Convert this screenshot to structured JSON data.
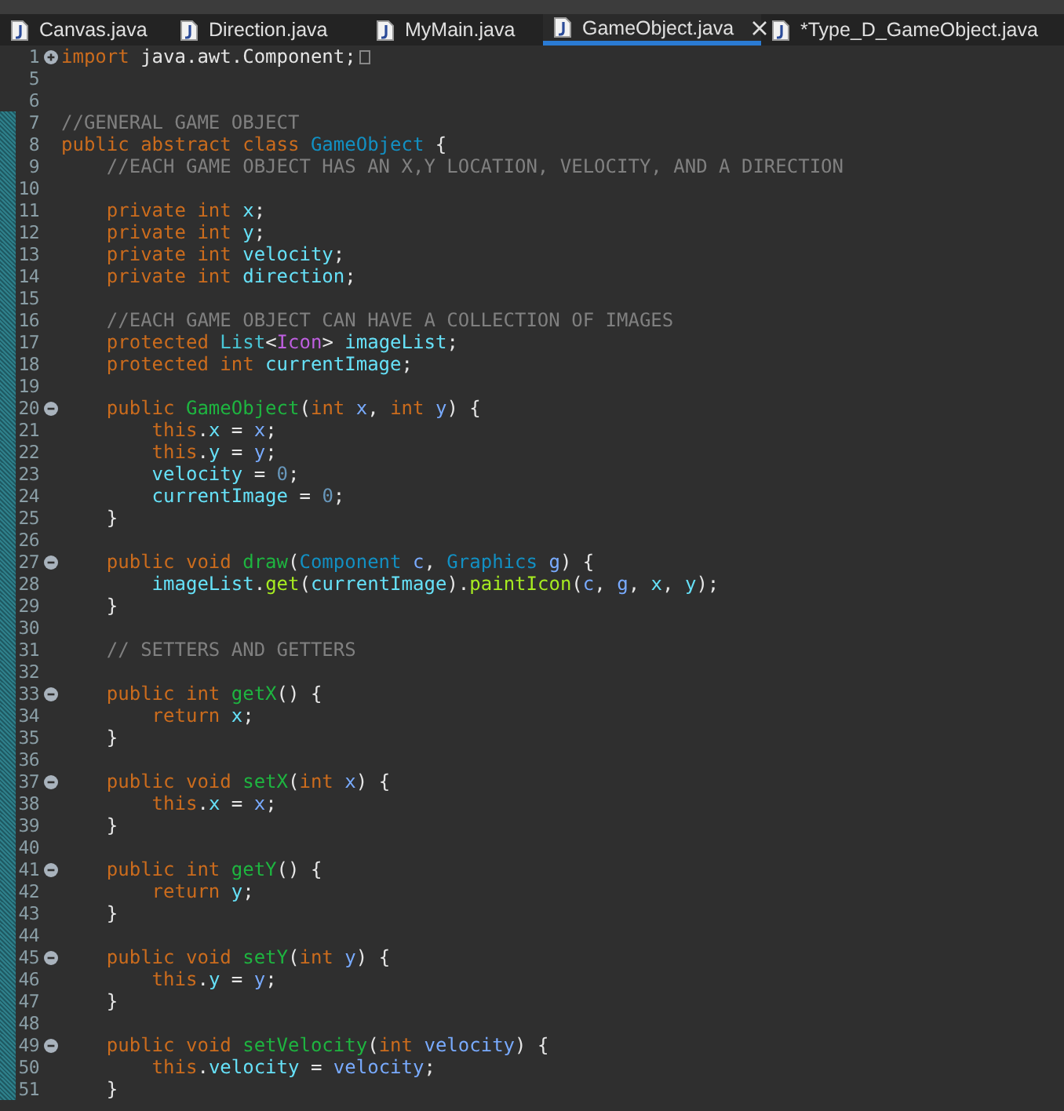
{
  "tabs": [
    {
      "label": "Canvas.java",
      "selected": false
    },
    {
      "label": "Direction.java",
      "selected": false
    },
    {
      "label": "MyMain.java",
      "selected": false
    },
    {
      "label": "GameObject.java",
      "selected": true
    },
    {
      "label": "*Type_D_GameObject.java",
      "selected": false
    }
  ],
  "lines": [
    {
      "number": "1",
      "expanded": false,
      "changed": false,
      "tokens": [
        {
          "kind": "keyword",
          "text": "import"
        },
        {
          "kind": "plain",
          "text": " java.awt.Component;"
        }
      ]
    },
    {
      "number": "5",
      "changed": false
    },
    {
      "number": "6",
      "changed": false
    },
    {
      "number": "7",
      "changed": true,
      "tokens": [
        {
          "kind": "comment",
          "text": "//GENERAL GAME OBJECT"
        }
      ]
    },
    {
      "number": "8",
      "changed": true,
      "tokens": [
        {
          "kind": "keyword",
          "text": "public abstract class "
        },
        {
          "kind": "type",
          "text": "GameObject"
        },
        {
          "kind": "plain",
          "text": " {"
        }
      ]
    },
    {
      "number": "9",
      "changed": true,
      "tokens": [
        {
          "kind": "comment",
          "text": "    //EACH GAME OBJECT HAS AN X,Y LOCATION, VELOCITY, AND A DIRECTION"
        }
      ]
    },
    {
      "number": "10",
      "changed": true
    },
    {
      "number": "11",
      "changed": true,
      "tokens": [
        {
          "kind": "keyword",
          "text": "    private int "
        },
        {
          "kind": "field",
          "text": "x"
        },
        {
          "kind": "plain",
          "text": ";"
        }
      ]
    },
    {
      "number": "12",
      "changed": true,
      "tokens": [
        {
          "kind": "keyword",
          "text": "    private int "
        },
        {
          "kind": "field",
          "text": "y"
        },
        {
          "kind": "plain",
          "text": ";"
        }
      ]
    },
    {
      "number": "13",
      "changed": true,
      "tokens": [
        {
          "kind": "keyword",
          "text": "    private int "
        },
        {
          "kind": "field",
          "text": "velocity"
        },
        {
          "kind": "plain",
          "text": ";"
        }
      ]
    },
    {
      "number": "14",
      "changed": true,
      "tokens": [
        {
          "kind": "keyword",
          "text": "    private int "
        },
        {
          "kind": "field",
          "text": "direction"
        },
        {
          "kind": "plain",
          "text": ";"
        }
      ]
    },
    {
      "number": "15",
      "changed": true
    },
    {
      "number": "16",
      "changed": true,
      "tokens": [
        {
          "kind": "comment",
          "text": "    //EACH GAME OBJECT CAN HAVE A COLLECTION OF IMAGES"
        }
      ]
    },
    {
      "number": "17",
      "changed": true,
      "tokens": [
        {
          "kind": "keyword",
          "text": "    protected "
        },
        {
          "kind": "interface",
          "text": "List"
        },
        {
          "kind": "plain",
          "text": "<"
        },
        {
          "kind": "typeparam",
          "text": "Icon"
        },
        {
          "kind": "plain",
          "text": "> "
        },
        {
          "kind": "field",
          "text": "imageList"
        },
        {
          "kind": "plain",
          "text": ";"
        }
      ]
    },
    {
      "number": "18",
      "changed": true,
      "tokens": [
        {
          "kind": "keyword",
          "text": "    protected int "
        },
        {
          "kind": "field",
          "text": "currentImage"
        },
        {
          "kind": "plain",
          "text": ";"
        }
      ]
    },
    {
      "number": "19",
      "changed": true
    },
    {
      "number": "20",
      "expanded": true,
      "changed": true,
      "tokens": [
        {
          "kind": "keyword",
          "text": "    public "
        },
        {
          "kind": "method",
          "text": "GameObject"
        },
        {
          "kind": "plain",
          "text": "("
        },
        {
          "kind": "keyword",
          "text": "int "
        },
        {
          "kind": "param",
          "text": "x"
        },
        {
          "kind": "plain",
          "text": ", "
        },
        {
          "kind": "keyword",
          "text": "int "
        },
        {
          "kind": "param",
          "text": "y"
        },
        {
          "kind": "plain",
          "text": ") {"
        }
      ]
    },
    {
      "number": "21",
      "changed": true,
      "tokens": [
        {
          "kind": "keyword",
          "text": "        this"
        },
        {
          "kind": "plain",
          "text": "."
        },
        {
          "kind": "field",
          "text": "x"
        },
        {
          "kind": "plain",
          "text": " = "
        },
        {
          "kind": "param",
          "text": "x"
        },
        {
          "kind": "plain",
          "text": ";"
        }
      ]
    },
    {
      "number": "22",
      "changed": true,
      "tokens": [
        {
          "kind": "keyword",
          "text": "        this"
        },
        {
          "kind": "plain",
          "text": "."
        },
        {
          "kind": "field",
          "text": "y"
        },
        {
          "kind": "plain",
          "text": " = "
        },
        {
          "kind": "param",
          "text": "y"
        },
        {
          "kind": "plain",
          "text": ";"
        }
      ]
    },
    {
      "number": "23",
      "changed": true,
      "tokens": [
        {
          "kind": "field",
          "text": "        velocity"
        },
        {
          "kind": "plain",
          "text": " = "
        },
        {
          "kind": "number",
          "text": "0"
        },
        {
          "kind": "plain",
          "text": ";"
        }
      ]
    },
    {
      "number": "24",
      "changed": true,
      "tokens": [
        {
          "kind": "field",
          "text": "        currentImage"
        },
        {
          "kind": "plain",
          "text": " = "
        },
        {
          "kind": "number",
          "text": "0"
        },
        {
          "kind": "plain",
          "text": ";"
        }
      ]
    },
    {
      "number": "25",
      "changed": true,
      "tokens": [
        {
          "kind": "plain",
          "text": "    }"
        }
      ]
    },
    {
      "number": "26",
      "changed": true
    },
    {
      "number": "27",
      "expanded": true,
      "changed": true,
      "tokens": [
        {
          "kind": "keyword",
          "text": "    public void "
        },
        {
          "kind": "method",
          "text": "draw"
        },
        {
          "kind": "plain",
          "text": "("
        },
        {
          "kind": "type",
          "text": "Component "
        },
        {
          "kind": "param",
          "text": "c"
        },
        {
          "kind": "plain",
          "text": ", "
        },
        {
          "kind": "type",
          "text": "Graphics "
        },
        {
          "kind": "param",
          "text": "g"
        },
        {
          "kind": "plain",
          "text": ") {"
        }
      ]
    },
    {
      "number": "28",
      "changed": true,
      "tokens": [
        {
          "kind": "field",
          "text": "        imageList"
        },
        {
          "kind": "plain",
          "text": "."
        },
        {
          "kind": "call",
          "text": "get"
        },
        {
          "kind": "plain",
          "text": "("
        },
        {
          "kind": "field",
          "text": "currentImage"
        },
        {
          "kind": "plain",
          "text": ")."
        },
        {
          "kind": "call",
          "text": "paintIcon"
        },
        {
          "kind": "plain",
          "text": "("
        },
        {
          "kind": "param",
          "text": "c"
        },
        {
          "kind": "plain",
          "text": ", "
        },
        {
          "kind": "param",
          "text": "g"
        },
        {
          "kind": "plain",
          "text": ", "
        },
        {
          "kind": "field",
          "text": "x"
        },
        {
          "kind": "plain",
          "text": ", "
        },
        {
          "kind": "field",
          "text": "y"
        },
        {
          "kind": "plain",
          "text": ");"
        }
      ]
    },
    {
      "number": "29",
      "changed": true,
      "tokens": [
        {
          "kind": "plain",
          "text": "    }"
        }
      ]
    },
    {
      "number": "30",
      "changed": true
    },
    {
      "number": "31",
      "changed": true,
      "tokens": [
        {
          "kind": "comment",
          "text": "    // SETTERS AND GETTERS"
        }
      ]
    },
    {
      "number": "32",
      "changed": true
    },
    {
      "number": "33",
      "expanded": true,
      "changed": true,
      "tokens": [
        {
          "kind": "keyword",
          "text": "    public int "
        },
        {
          "kind": "method",
          "text": "getX"
        },
        {
          "kind": "plain",
          "text": "() {"
        }
      ]
    },
    {
      "number": "34",
      "changed": true,
      "tokens": [
        {
          "kind": "keyword",
          "text": "        return "
        },
        {
          "kind": "field",
          "text": "x"
        },
        {
          "kind": "plain",
          "text": ";"
        }
      ]
    },
    {
      "number": "35",
      "changed": true,
      "tokens": [
        {
          "kind": "plain",
          "text": "    }"
        }
      ]
    },
    {
      "number": "36",
      "changed": true
    },
    {
      "number": "37",
      "expanded": true,
      "changed": true,
      "tokens": [
        {
          "kind": "keyword",
          "text": "    public void "
        },
        {
          "kind": "method",
          "text": "setX"
        },
        {
          "kind": "plain",
          "text": "("
        },
        {
          "kind": "keyword",
          "text": "int "
        },
        {
          "kind": "param",
          "text": "x"
        },
        {
          "kind": "plain",
          "text": ") {"
        }
      ]
    },
    {
      "number": "38",
      "changed": true,
      "tokens": [
        {
          "kind": "keyword",
          "text": "        this"
        },
        {
          "kind": "plain",
          "text": "."
        },
        {
          "kind": "field",
          "text": "x"
        },
        {
          "kind": "plain",
          "text": " = "
        },
        {
          "kind": "param",
          "text": "x"
        },
        {
          "kind": "plain",
          "text": ";"
        }
      ]
    },
    {
      "number": "39",
      "changed": true,
      "tokens": [
        {
          "kind": "plain",
          "text": "    }"
        }
      ]
    },
    {
      "number": "40",
      "changed": true
    },
    {
      "number": "41",
      "expanded": true,
      "changed": true,
      "tokens": [
        {
          "kind": "keyword",
          "text": "    public int "
        },
        {
          "kind": "method",
          "text": "getY"
        },
        {
          "kind": "plain",
          "text": "() {"
        }
      ]
    },
    {
      "number": "42",
      "changed": true,
      "tokens": [
        {
          "kind": "keyword",
          "text": "        return "
        },
        {
          "kind": "field",
          "text": "y"
        },
        {
          "kind": "plain",
          "text": ";"
        }
      ]
    },
    {
      "number": "43",
      "changed": true,
      "tokens": [
        {
          "kind": "plain",
          "text": "    }"
        }
      ]
    },
    {
      "number": "44",
      "changed": true
    },
    {
      "number": "45",
      "expanded": true,
      "changed": true,
      "tokens": [
        {
          "kind": "keyword",
          "text": "    public void "
        },
        {
          "kind": "method",
          "text": "setY"
        },
        {
          "kind": "plain",
          "text": "("
        },
        {
          "kind": "keyword",
          "text": "int "
        },
        {
          "kind": "param",
          "text": "y"
        },
        {
          "kind": "plain",
          "text": ") {"
        }
      ]
    },
    {
      "number": "46",
      "changed": true,
      "tokens": [
        {
          "kind": "keyword",
          "text": "        this"
        },
        {
          "kind": "plain",
          "text": "."
        },
        {
          "kind": "field",
          "text": "y"
        },
        {
          "kind": "plain",
          "text": " = "
        },
        {
          "kind": "param",
          "text": "y"
        },
        {
          "kind": "plain",
          "text": ";"
        }
      ]
    },
    {
      "number": "47",
      "changed": true,
      "tokens": [
        {
          "kind": "plain",
          "text": "    }"
        }
      ]
    },
    {
      "number": "48",
      "changed": true
    },
    {
      "number": "49",
      "expanded": true,
      "changed": true,
      "tokens": [
        {
          "kind": "keyword",
          "text": "    public void "
        },
        {
          "kind": "method",
          "text": "setVelocity"
        },
        {
          "kind": "plain",
          "text": "("
        },
        {
          "kind": "keyword",
          "text": "int "
        },
        {
          "kind": "param",
          "text": "velocity"
        },
        {
          "kind": "plain",
          "text": ") {"
        }
      ]
    },
    {
      "number": "50",
      "changed": true,
      "tokens": [
        {
          "kind": "keyword",
          "text": "        this"
        },
        {
          "kind": "plain",
          "text": "."
        },
        {
          "kind": "field",
          "text": "velocity"
        },
        {
          "kind": "plain",
          "text": " = "
        },
        {
          "kind": "param",
          "text": "velocity"
        },
        {
          "kind": "plain",
          "text": ";"
        }
      ]
    },
    {
      "number": "51",
      "changed": true,
      "tokens": [
        {
          "kind": "plain",
          "text": "    }"
        }
      ]
    }
  ]
}
